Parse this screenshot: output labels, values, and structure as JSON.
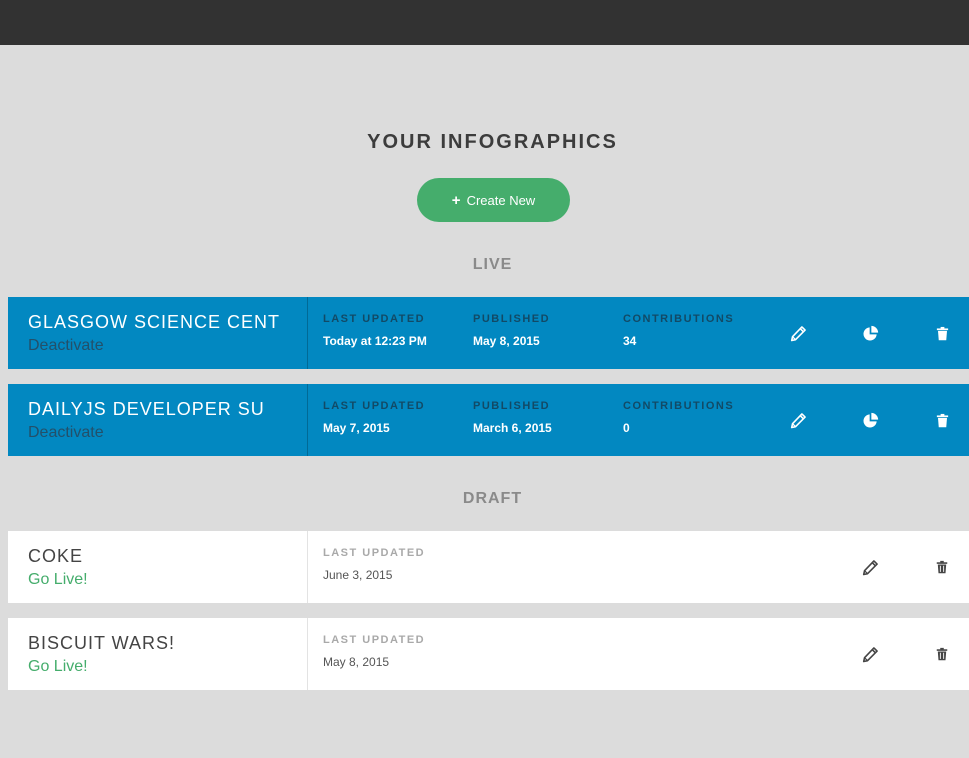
{
  "header": {
    "title": "YOUR INFOGRAPHICS",
    "create_button": {
      "icon": "plus-icon",
      "label": "Create New"
    }
  },
  "sections": {
    "live_heading": "LIVE",
    "draft_heading": "DRAFT"
  },
  "colors": {
    "topbar": "#323232",
    "background": "#dcdcdc",
    "live_card": "#0288c1",
    "accent_green": "#45ad6c"
  },
  "live": [
    {
      "title": "GLASGOW SCIENCE CENT",
      "action": "Deactivate",
      "last_updated_label": "LAST UPDATED",
      "last_updated": "Today at 12:23 PM",
      "published_label": "PUBLISHED",
      "published": "May 8, 2015",
      "contributions_label": "CONTRIBUTIONS",
      "contributions": "34",
      "icons": [
        "pencil-icon",
        "pie-chart-icon",
        "trash-icon"
      ]
    },
    {
      "title": "DAILYJS DEVELOPER SU",
      "action": "Deactivate",
      "last_updated_label": "LAST UPDATED",
      "last_updated": "May 7, 2015",
      "published_label": "PUBLISHED",
      "published": "March 6, 2015",
      "contributions_label": "CONTRIBUTIONS",
      "contributions": "0",
      "icons": [
        "pencil-icon",
        "pie-chart-icon",
        "trash-icon"
      ]
    }
  ],
  "draft": [
    {
      "title": "COKE",
      "action": "Go Live!",
      "last_updated_label": "LAST UPDATED",
      "last_updated": "June 3, 2015",
      "icons": [
        "pencil-icon",
        "trash-icon"
      ]
    },
    {
      "title": "BISCUIT WARS!",
      "action": "Go Live!",
      "last_updated_label": "LAST UPDATED",
      "last_updated": "May 8, 2015",
      "icons": [
        "pencil-icon",
        "trash-icon"
      ]
    }
  ]
}
